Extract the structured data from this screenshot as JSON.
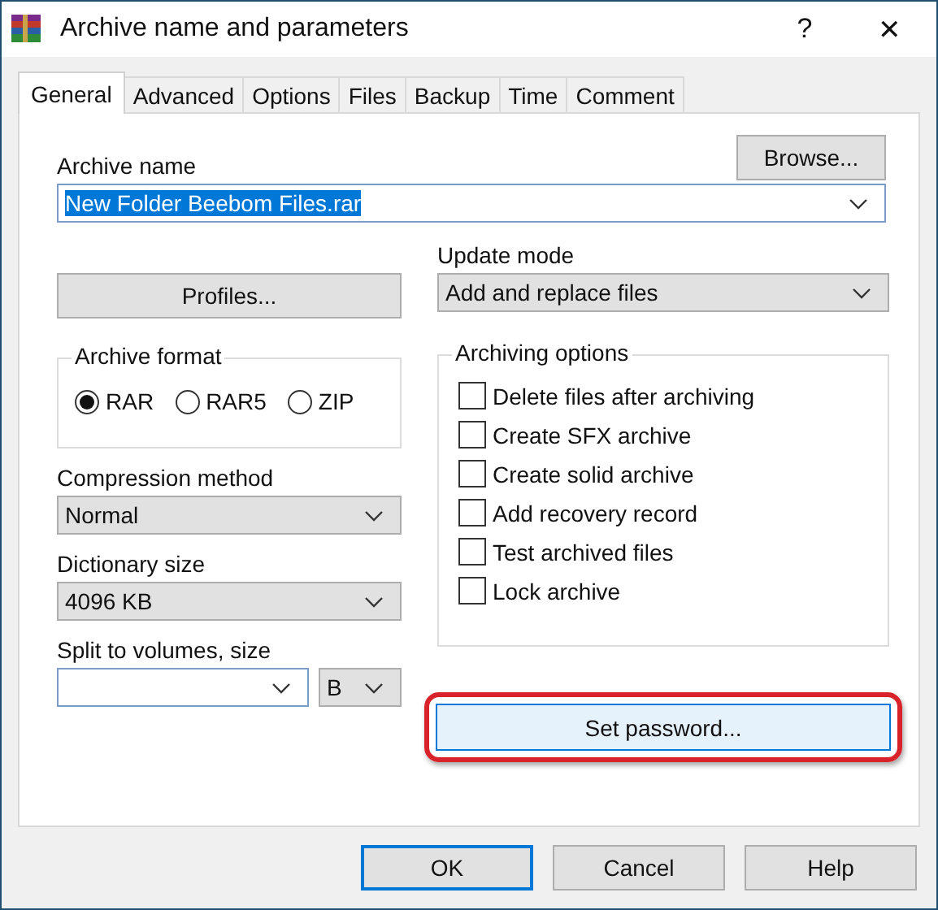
{
  "window": {
    "title": "Archive name and parameters",
    "help": "?",
    "close": "✕"
  },
  "tabs": [
    {
      "label": "General",
      "selected": true
    },
    {
      "label": "Advanced",
      "selected": false
    },
    {
      "label": "Options",
      "selected": false
    },
    {
      "label": "Files",
      "selected": false
    },
    {
      "label": "Backup",
      "selected": false
    },
    {
      "label": "Time",
      "selected": false
    },
    {
      "label": "Comment",
      "selected": false
    }
  ],
  "archive_name": {
    "label": "Archive name",
    "value": "New Folder Beebom Files.rar",
    "text_selected": true,
    "browse": "Browse..."
  },
  "profiles": "Profiles...",
  "update_mode": {
    "label": "Update mode",
    "value": "Add and replace files"
  },
  "archive_format": {
    "title": "Archive format",
    "options": [
      {
        "label": "RAR",
        "selected": true
      },
      {
        "label": "RAR5",
        "selected": false
      },
      {
        "label": "ZIP",
        "selected": false
      }
    ]
  },
  "compression_method": {
    "label": "Compression method",
    "value": "Normal"
  },
  "dictionary_size": {
    "label": "Dictionary size",
    "value": "4096 KB"
  },
  "split": {
    "label": "Split to volumes, size",
    "unit": "B"
  },
  "archiving_options": {
    "title": "Archiving options",
    "items": [
      {
        "label": "Delete files after archiving",
        "checked": false
      },
      {
        "label": "Create SFX archive",
        "checked": false
      },
      {
        "label": "Create solid archive",
        "checked": false
      },
      {
        "label": "Add recovery record",
        "checked": false
      },
      {
        "label": "Test archived files",
        "checked": false
      },
      {
        "label": "Lock archive",
        "checked": false
      }
    ]
  },
  "password": {
    "label": "Set password...",
    "highlighted": true
  },
  "buttons": [
    {
      "label": "OK",
      "default": true
    },
    {
      "label": "Cancel",
      "default": false
    },
    {
      "label": "Help",
      "default": false
    }
  ]
}
